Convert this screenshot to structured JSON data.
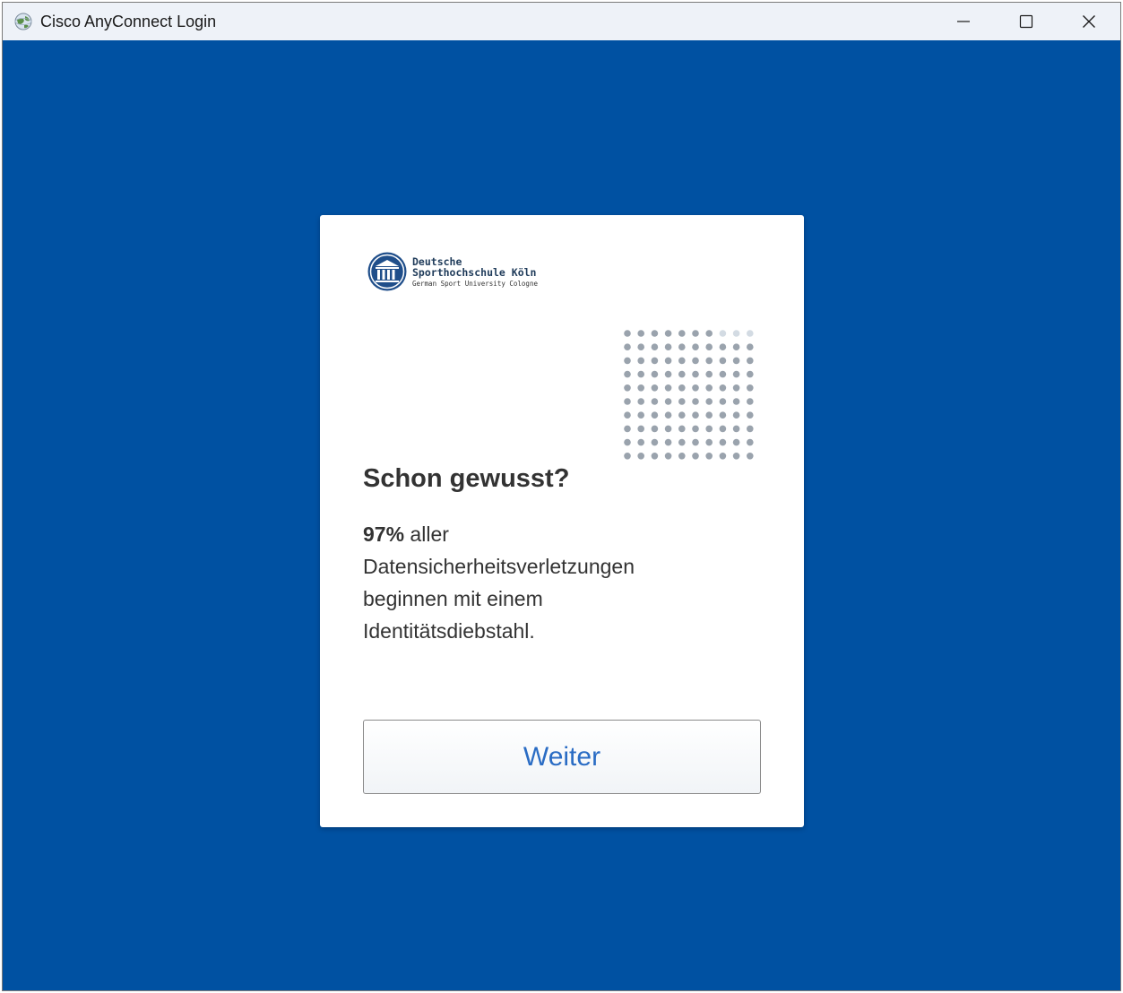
{
  "window": {
    "title": "Cisco AnyConnect Login"
  },
  "logo": {
    "line1": "Deutsche",
    "line2": "Sporthochschule Köln",
    "line3": "German Sport University Cologne"
  },
  "card": {
    "headline": "Schon gewusst?",
    "stat": "97%",
    "body_rest": " aller Datensicherheitsverletzungen beginnen mit einem Identitätsdiebstahl.",
    "button_label": "Weiter"
  },
  "colors": {
    "background_blue": "#0051a2",
    "button_text": "#2a6cc4",
    "dot_gray": "#9aa3ad",
    "dot_light": "#d3dbe3"
  },
  "icons": {
    "app": "cisco-globe-icon",
    "minimize": "minimize-icon",
    "maximize": "maximize-icon",
    "close": "close-icon",
    "logo": "university-building-icon",
    "pattern": "dot-grid-pattern"
  }
}
